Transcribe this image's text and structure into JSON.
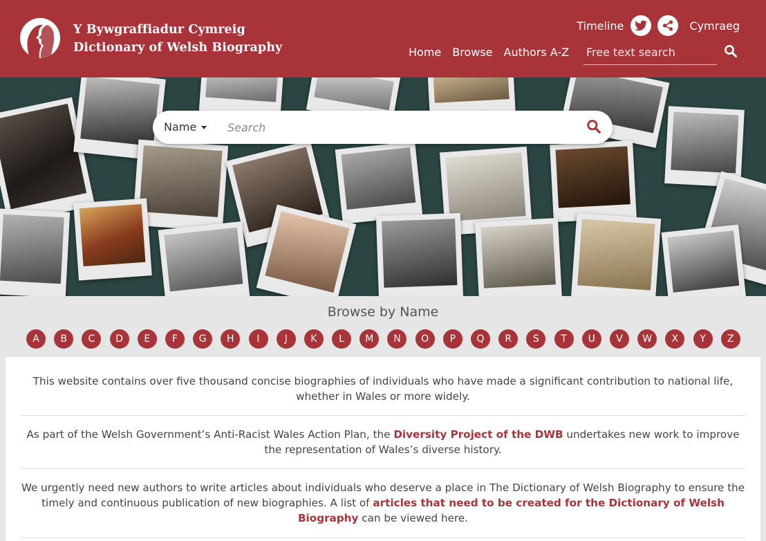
{
  "header": {
    "title_welsh": "Y Bywgraffiadur Cymreig",
    "title_english": "Dictionary of Welsh Biography",
    "timeline_label": "Timeline",
    "language_label": "Cymraeg",
    "nav": [
      {
        "label": "Home"
      },
      {
        "label": "Browse"
      },
      {
        "label": "Authors A-Z"
      }
    ],
    "search_placeholder": "Free text search",
    "icons": {
      "twitter": "twitter-bird-icon",
      "share": "share-icon",
      "search": "search-icon"
    }
  },
  "hero": {
    "search_type_label": "Name",
    "search_placeholder": "Search"
  },
  "browse": {
    "title": "Browse by Name",
    "letters": [
      "A",
      "B",
      "C",
      "D",
      "E",
      "F",
      "G",
      "H",
      "I",
      "J",
      "K",
      "L",
      "M",
      "N",
      "O",
      "P",
      "Q",
      "R",
      "S",
      "T",
      "U",
      "V",
      "W",
      "X",
      "Y",
      "Z"
    ]
  },
  "content": {
    "p1": "This website contains over five thousand concise biographies of individuals who have made a significant contribution to national life, whether in Wales or more widely.",
    "p2_before": "As part of the Welsh Government’s Anti-Racist Wales Action Plan, the ",
    "p2_link": "Diversity Project of the DWB",
    "p2_after": " undertakes new work to improve the representation of Wales’s diverse history.",
    "p3_before": "We urgently need new authors to write articles about individuals who deserve a place in The Dictionary of Welsh Biography to ensure the timely and continuous publication of new biographies. A list of ",
    "p3_link": "articles that need to be created for the Dictionary of Welsh Biography",
    "p3_after": " can be viewed here."
  },
  "colors": {
    "brand_red": "#a8343a",
    "hero_bg": "#2b4543",
    "page_bg": "#e6e6e6"
  }
}
